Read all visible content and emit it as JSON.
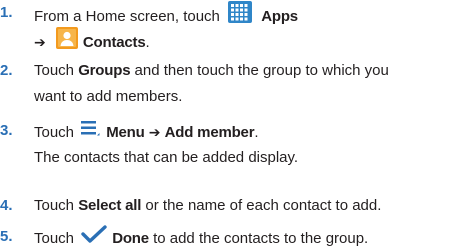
{
  "steps": [
    {
      "number": "1.",
      "line1_text": "From a Home screen, touch",
      "line1_bold": "Apps",
      "line1_icon": "apps-grid-icon",
      "line2_arrow": "➔",
      "line2_icon": "contacts-icon",
      "line2_bold": "Contacts",
      "line2_end": "."
    },
    {
      "number": "2.",
      "pre": "Touch ",
      "bold": "Groups",
      "post": " and then touch the group to which you",
      "line2": "want to add members."
    },
    {
      "number": "3.",
      "pre": "Touch ",
      "icon": "menu-icon",
      "bold1": "Menu",
      "arrow": "➔",
      "bold2": "Add member",
      "end": ".",
      "line2": "The contacts that can be added display."
    },
    {
      "number": "4.",
      "pre": "Touch ",
      "bold": "Select all",
      "post": " or the name of each contact to add."
    },
    {
      "number": "5.",
      "pre": "Touch ",
      "icon": "checkmark-icon",
      "bold": "Done",
      "post": " to add the contacts to the group."
    }
  ],
  "colors": {
    "step_number": "#2a6fb5",
    "text": "#231f20",
    "apps_icon": "#2f86c8",
    "contacts_icon": "#f39a1e",
    "menu_icon": "#2a6fb5",
    "check_icon": "#2a6fb5"
  }
}
